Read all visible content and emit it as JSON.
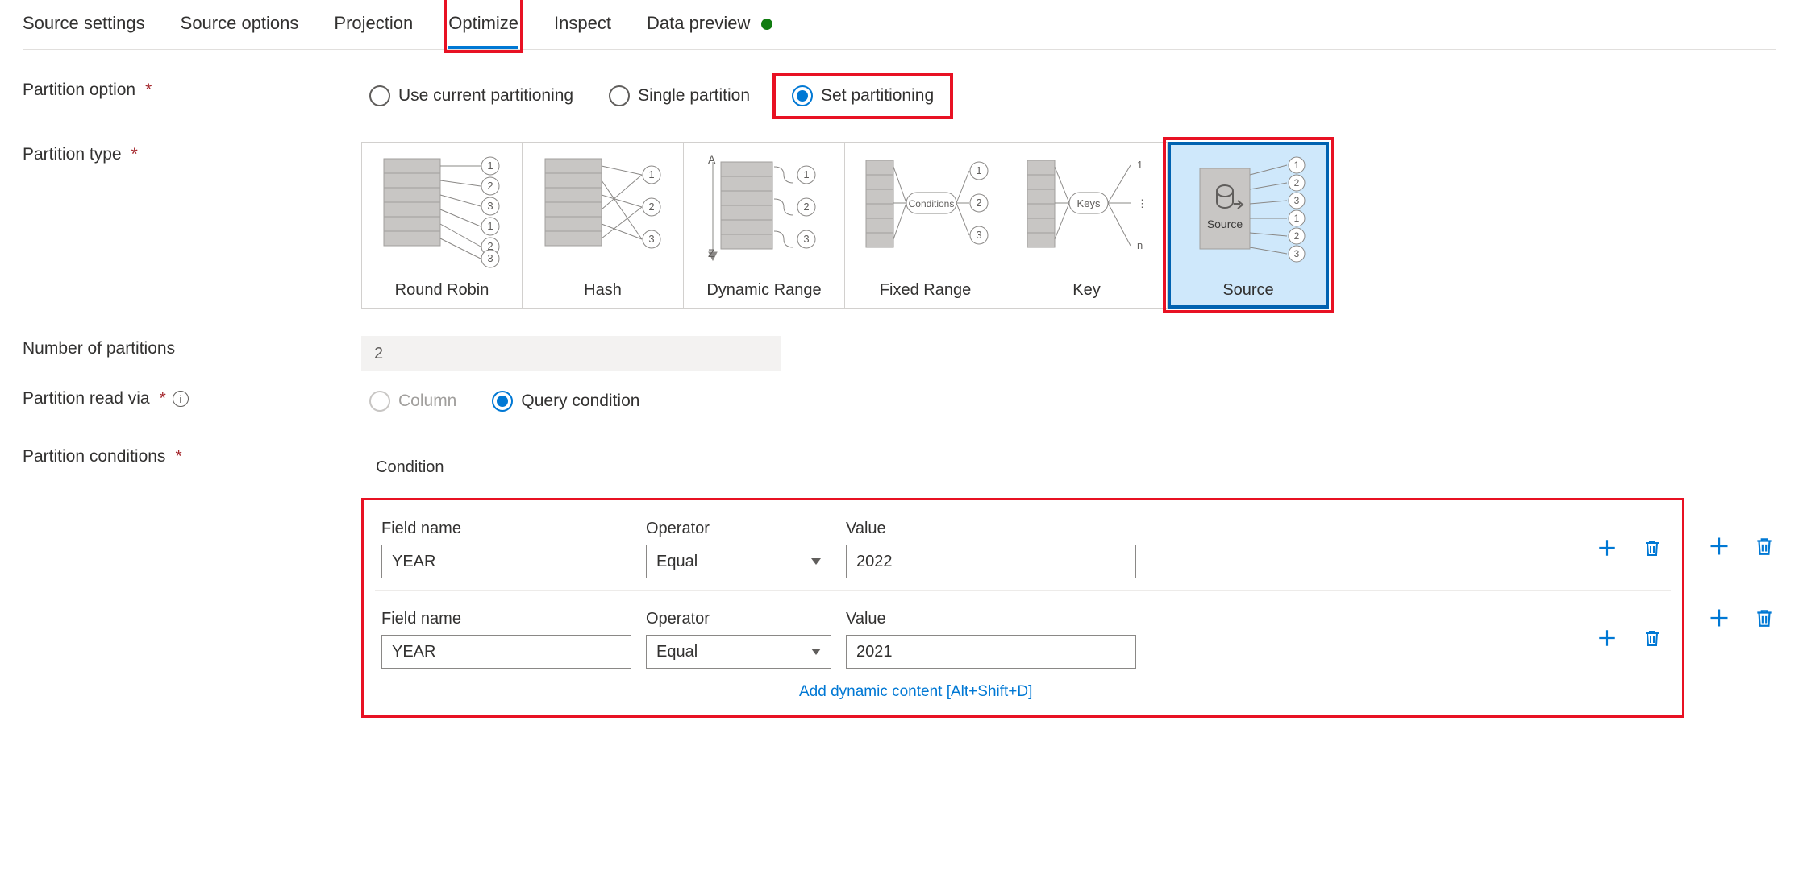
{
  "tabs": {
    "items": [
      {
        "label": "Source settings"
      },
      {
        "label": "Source options"
      },
      {
        "label": "Projection"
      },
      {
        "label": "Optimize",
        "active": true,
        "highlight": true
      },
      {
        "label": "Inspect"
      },
      {
        "label": "Data preview",
        "dot": true
      }
    ]
  },
  "labels": {
    "partition_option": "Partition option",
    "partition_type": "Partition type",
    "number_of_partitions": "Number of partitions",
    "partition_read_via": "Partition read via",
    "partition_conditions": "Partition conditions",
    "condition": "Condition",
    "field_name": "Field name",
    "operator": "Operator",
    "value": "Value",
    "add_dynamic": "Add dynamic content [Alt+Shift+D]"
  },
  "partition_option": {
    "options": [
      {
        "label": "Use current partitioning",
        "checked": false
      },
      {
        "label": "Single partition",
        "checked": false
      },
      {
        "label": "Set partitioning",
        "checked": true,
        "highlight": true
      }
    ]
  },
  "partition_type": {
    "options": [
      {
        "label": "Round Robin"
      },
      {
        "label": "Hash"
      },
      {
        "label": "Dynamic Range"
      },
      {
        "label": "Fixed Range"
      },
      {
        "label": "Key"
      },
      {
        "label": "Source",
        "selected": true,
        "highlight": true
      }
    ]
  },
  "number_of_partitions": "2",
  "partition_read_via": {
    "options": [
      {
        "label": "Column",
        "checked": false,
        "disabled": true
      },
      {
        "label": "Query condition",
        "checked": true
      }
    ]
  },
  "conditions": [
    {
      "field": "YEAR",
      "operator": "Equal",
      "value": "2022"
    },
    {
      "field": "YEAR",
      "operator": "Equal",
      "value": "2021"
    }
  ]
}
